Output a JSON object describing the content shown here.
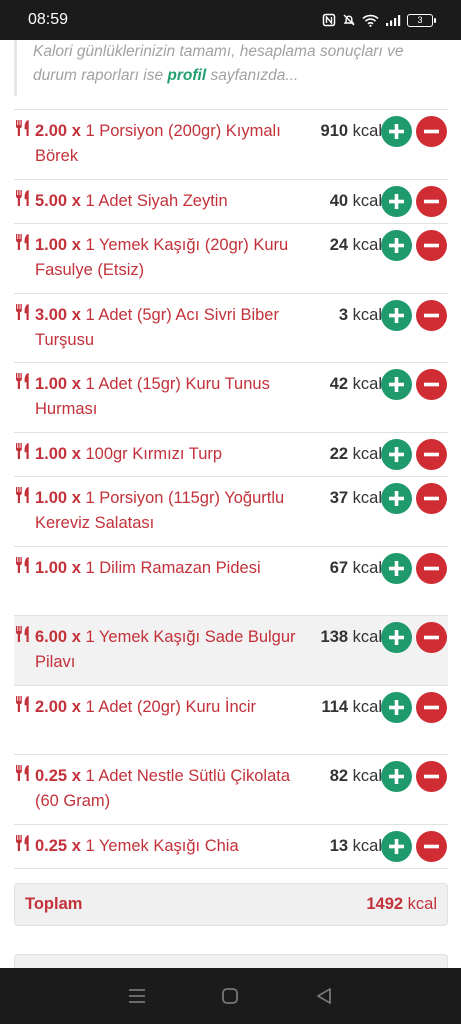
{
  "status_bar": {
    "time": "08:59",
    "battery": "3"
  },
  "info": {
    "text_before": "Kalori günlüklerinizin tamamı, hesaplama sonuçları ve durum raporları ise ",
    "link": "profil",
    "text_after": " sayfanızda..."
  },
  "items": [
    {
      "qty": "2.00 x",
      "name": "1 Porsiyon (200gr) Kıymalı Börek",
      "kcal": "910",
      "unit": "kcal"
    },
    {
      "qty": "5.00 x",
      "name": "1 Adet Siyah Zeytin",
      "kcal": "40",
      "unit": "kcal"
    },
    {
      "qty": "1.00 x",
      "name": "1 Yemek Kaşığı (20gr) Kuru Fasulye (Etsiz)",
      "kcal": "24",
      "unit": "kcal"
    },
    {
      "qty": "3.00 x",
      "name": "1 Adet (5gr) Acı Sivri Biber Turşusu",
      "kcal": "3",
      "unit": "kcal"
    },
    {
      "qty": "1.00 x",
      "name": "1 Adet (15gr) Kuru Tunus Hurması",
      "kcal": "42",
      "unit": "kcal"
    },
    {
      "qty": "1.00 x",
      "name": "100gr Kırmızı Turp",
      "kcal": "22",
      "unit": "kcal"
    },
    {
      "qty": "1.00 x",
      "name": "1 Porsiyon (115gr) Yoğurtlu Kereviz Salatası",
      "kcal": "37",
      "unit": "kcal"
    },
    {
      "qty": "1.00 x",
      "name": "1 Dilim Ramazan Pidesi",
      "kcal": "67",
      "unit": "kcal"
    },
    {
      "qty": "6.00 x",
      "name": "1 Yemek Kaşığı Sade Bulgur Pilavı",
      "kcal": "138",
      "unit": "kcal"
    },
    {
      "qty": "2.00 x",
      "name": "1 Adet (20gr) Kuru İncir",
      "kcal": "114",
      "unit": "kcal"
    },
    {
      "qty": "0.25 x",
      "name": "1 Adet Nestle Sütlü Çikolata (60 Gram)",
      "kcal": "82",
      "unit": "kcal"
    },
    {
      "qty": "0.25 x",
      "name": "1 Yemek Kaşığı Chia",
      "kcal": "13",
      "unit": "kcal"
    }
  ],
  "total": {
    "label": "Toplam",
    "value": "1492",
    "unit": "kcal"
  },
  "colors": {
    "accent_red": "#c3313a",
    "plus_green": "#1f9a6d",
    "minus_red": "#cf2d33",
    "link_green": "#22a072"
  },
  "icons": {
    "item": "fork-knife-icon",
    "add": "plus-icon",
    "remove": "minus-icon"
  }
}
